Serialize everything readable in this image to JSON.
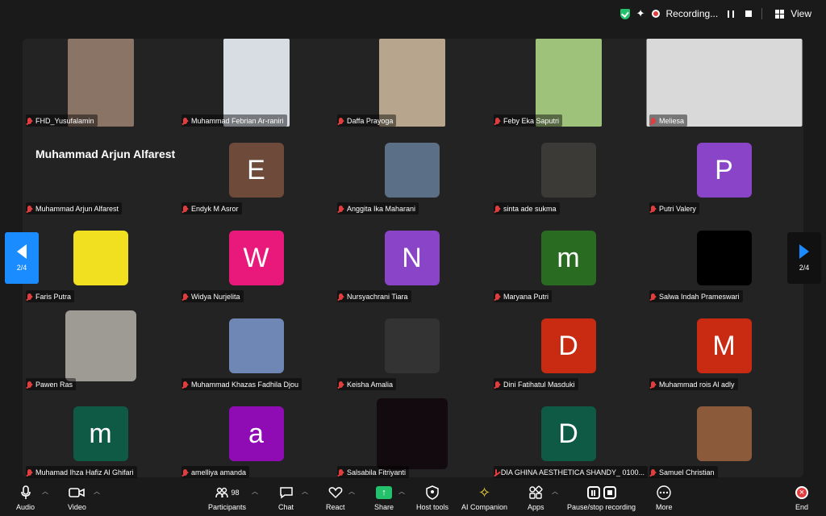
{
  "status": {
    "recording_label": "Recording...",
    "view_label": "View"
  },
  "pagination": {
    "left": "2/4",
    "right": "2/4"
  },
  "participants": [
    {
      "name": "FHD_Yusufalamin",
      "kind": "photo",
      "bg": "#8a7466"
    },
    {
      "name": "Muhammad Febrian Ar-raniri",
      "kind": "photo",
      "bg": "#d8dde4"
    },
    {
      "name": "Daffa Prayoga",
      "kind": "photo",
      "bg": "#b7a68d"
    },
    {
      "name": "Feby Eka Saputri",
      "kind": "photo",
      "bg": "#9fc27a"
    },
    {
      "name": "Meliesa",
      "kind": "wide",
      "bg": "#d9d9d9"
    },
    {
      "name": "Muhammad Arjun Alfarest",
      "kind": "text",
      "display": "Muhammad Arjun Alfarest"
    },
    {
      "name": "Endyk M Asror",
      "kind": "avatar",
      "letter": "E",
      "bg": "#6e4a3a"
    },
    {
      "name": "Anggita Ika Maharani",
      "kind": "square",
      "bg": "#5b6f86"
    },
    {
      "name": "sinta ade sukma",
      "kind": "square",
      "bg": "#3b3a36"
    },
    {
      "name": "Putri Valery",
      "kind": "avatar",
      "letter": "P",
      "bg": "#8a44c8"
    },
    {
      "name": "Faris Putra",
      "kind": "square",
      "bg": "#f0e020"
    },
    {
      "name": "Widya Nurjelita",
      "kind": "avatar",
      "letter": "W",
      "bg": "#e8197a"
    },
    {
      "name": "Nursyachrani Tiara",
      "kind": "avatar",
      "letter": "N",
      "bg": "#8a44c8"
    },
    {
      "name": "Maryana Putri",
      "kind": "avatar",
      "letter": "m",
      "bg": "#2a6b22"
    },
    {
      "name": "Salwa Indah Prameswari",
      "kind": "square",
      "bg": "#000000"
    },
    {
      "name": "Pawen Ras",
      "kind": "square88",
      "bg": "#9e9b95"
    },
    {
      "name": "Muhammad Khazas Fadhila Djou",
      "kind": "square",
      "bg": "#6f87b5"
    },
    {
      "name": "Keisha Amalia",
      "kind": "square",
      "bg": "#333333"
    },
    {
      "name": "Dini Fatihatul Masduki",
      "kind": "avatar",
      "letter": "D",
      "bg": "#c92a12"
    },
    {
      "name": "Muhammad rois Al adly",
      "kind": "avatar",
      "letter": "M",
      "bg": "#c92a12"
    },
    {
      "name": "Muhamad Ihza Hafiz Al Ghifari",
      "kind": "avatar",
      "letter": "m",
      "bg": "#0e5a45"
    },
    {
      "name": "amelliya amanda",
      "kind": "avatar",
      "letter": "a",
      "bg": "#8f0cb5"
    },
    {
      "name": "Salsabila Fitriyanti",
      "kind": "square88",
      "bg": "#120a0e"
    },
    {
      "name": "DIA GHINA AESTHETICA SHANDY_ 0100...",
      "kind": "avatar",
      "letter": "D",
      "bg": "#0e5a45"
    },
    {
      "name": "Samuel Christian",
      "kind": "square",
      "bg": "#8a5a3a"
    }
  ],
  "toolbar": {
    "audio": "Audio",
    "video": "Video",
    "participants": "Participants",
    "participants_count": "98",
    "chat": "Chat",
    "react": "React",
    "share": "Share",
    "host_tools": "Host tools",
    "ai_companion": "AI Companion",
    "apps": "Apps",
    "pause_stop": "Pause/stop recording",
    "more": "More",
    "end": "End"
  }
}
